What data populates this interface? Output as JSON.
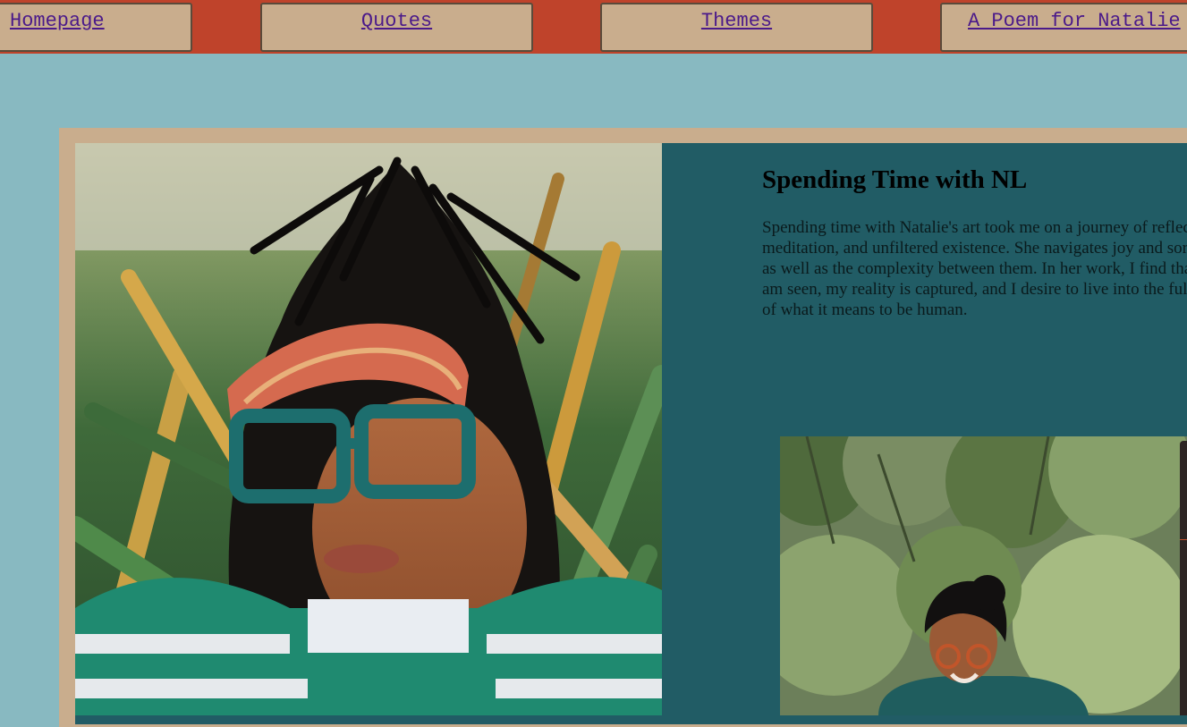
{
  "nav": {
    "items": [
      {
        "label": "Homepage"
      },
      {
        "label": "Quotes"
      },
      {
        "label": "Themes"
      },
      {
        "label": "A Poem for Natalie"
      }
    ]
  },
  "main": {
    "heading": "Spending Time with NL",
    "paragraph": "Spending time with Natalie's art took me on a journey of reflection, meditation, and unfiltered existence. She navigates joy and sorrow as well as the complexity between them. In her work, I find that I am seen, my reality is captured, and I desire to live into the fullness of what it means to be human."
  },
  "colors": {
    "navbar_bg": "#bf432b",
    "tab_bg": "#c9ad8d",
    "link": "#4b1a8a",
    "page_bg": "#88b9c1",
    "panel_bg": "#215c65"
  }
}
